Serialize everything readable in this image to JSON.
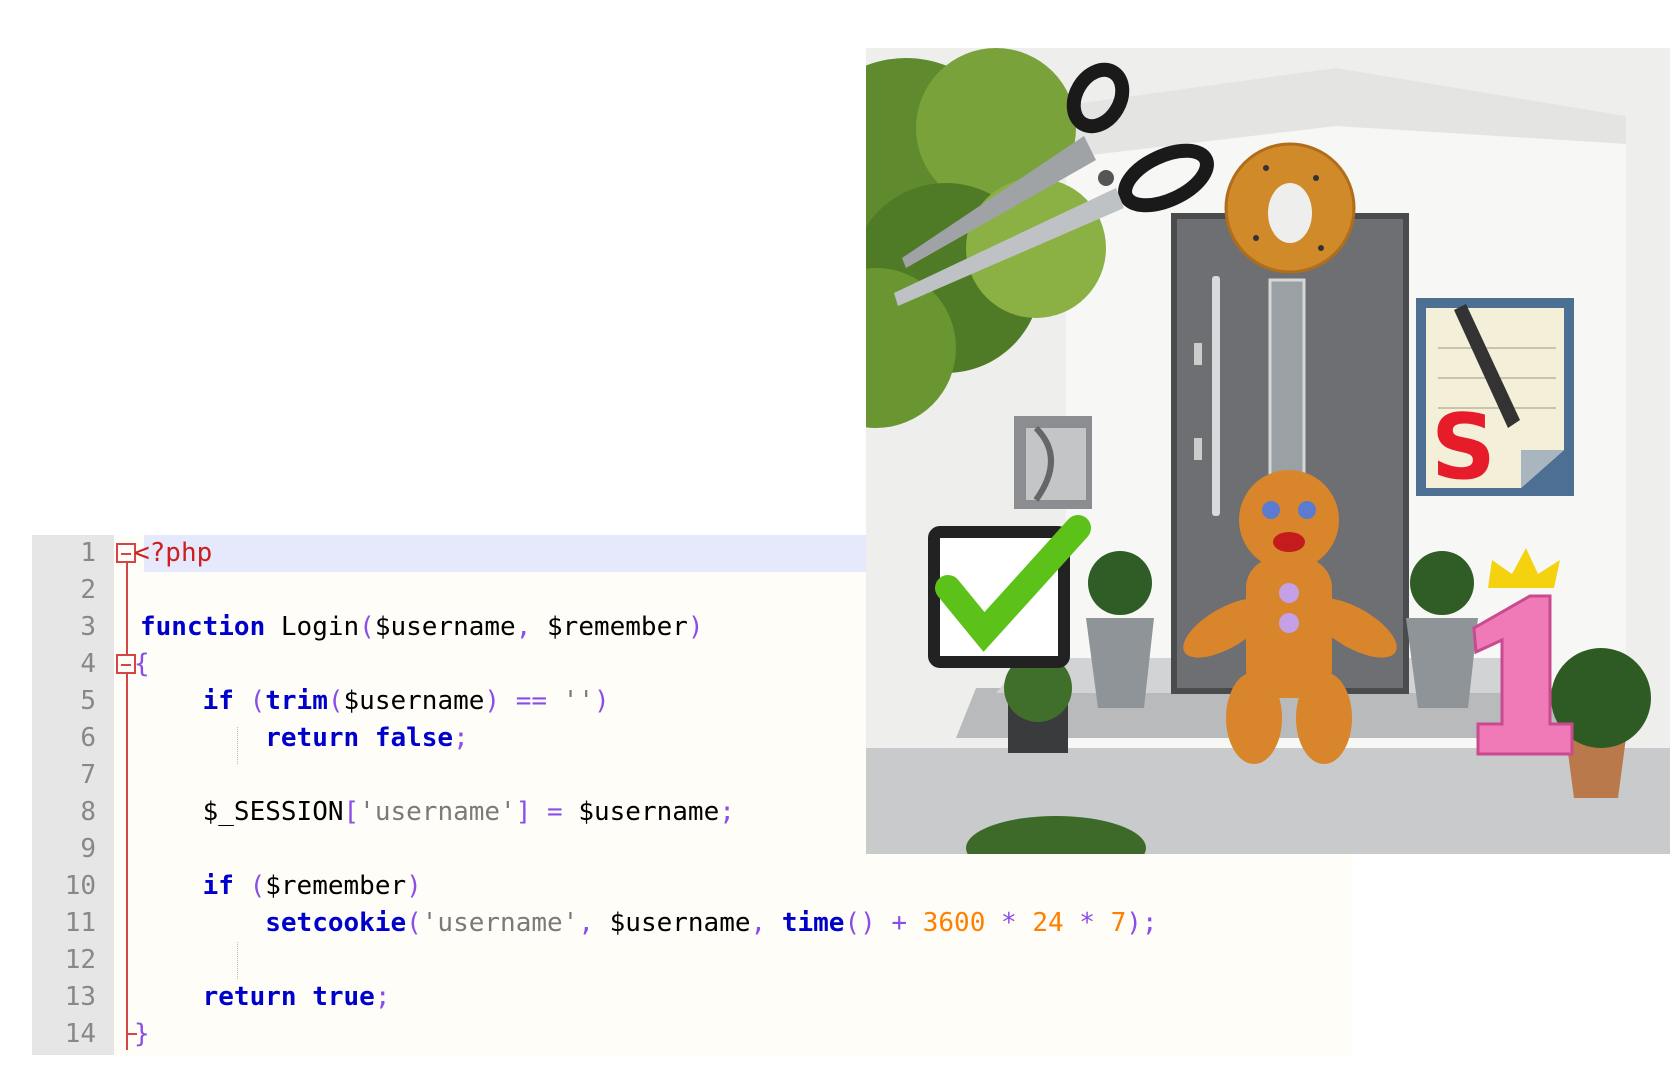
{
  "editor": {
    "line_numbers": [
      "1",
      "2",
      "3",
      "4",
      "5",
      "6",
      "7",
      "8",
      "9",
      "10",
      "11",
      "12",
      "13",
      "14"
    ],
    "lines": [
      [
        {
          "t": "<?php",
          "c": "php"
        }
      ],
      [],
      [
        {
          "t": "function",
          "c": "kw"
        },
        {
          "t": " Login",
          "c": "fn"
        },
        {
          "t": "(",
          "c": "op"
        },
        {
          "t": "$username",
          "c": "var"
        },
        {
          "t": ", ",
          "c": "op"
        },
        {
          "t": "$remember",
          "c": "var"
        },
        {
          "t": ")",
          "c": "op"
        }
      ],
      [
        {
          "t": "{",
          "c": "op"
        }
      ],
      [
        {
          "t": "    "
        },
        {
          "t": "if",
          "c": "kw"
        },
        {
          "t": " (",
          "c": "op"
        },
        {
          "t": "trim",
          "c": "kw"
        },
        {
          "t": "(",
          "c": "op"
        },
        {
          "t": "$username",
          "c": "var"
        },
        {
          "t": ") == ",
          "c": "op"
        },
        {
          "t": "''",
          "c": "str"
        },
        {
          "t": ")",
          "c": "op"
        }
      ],
      [
        {
          "t": "        "
        },
        {
          "t": "return",
          "c": "kw"
        },
        {
          "t": " "
        },
        {
          "t": "false",
          "c": "kw"
        },
        {
          "t": ";",
          "c": "op"
        }
      ],
      [],
      [
        {
          "t": "    "
        },
        {
          "t": "$_SESSION",
          "c": "var"
        },
        {
          "t": "[",
          "c": "op"
        },
        {
          "t": "'username'",
          "c": "str"
        },
        {
          "t": "] = ",
          "c": "op"
        },
        {
          "t": "$username",
          "c": "var"
        },
        {
          "t": ";",
          "c": "op"
        }
      ],
      [],
      [
        {
          "t": "    "
        },
        {
          "t": "if",
          "c": "kw"
        },
        {
          "t": " (",
          "c": "op"
        },
        {
          "t": "$remember",
          "c": "var"
        },
        {
          "t": ")",
          "c": "op"
        }
      ],
      [
        {
          "t": "        "
        },
        {
          "t": "setcookie",
          "c": "kw"
        },
        {
          "t": "(",
          "c": "op"
        },
        {
          "t": "'username'",
          "c": "str"
        },
        {
          "t": ", ",
          "c": "op"
        },
        {
          "t": "$username",
          "c": "var"
        },
        {
          "t": ", ",
          "c": "op"
        },
        {
          "t": "time",
          "c": "kw"
        },
        {
          "t": "() + ",
          "c": "op"
        },
        {
          "t": "3600",
          "c": "num"
        },
        {
          "t": " * ",
          "c": "op"
        },
        {
          "t": "24",
          "c": "num"
        },
        {
          "t": " * ",
          "c": "op"
        },
        {
          "t": "7",
          "c": "num"
        },
        {
          "t": ");",
          "c": "op"
        }
      ],
      [],
      [
        {
          "t": "    "
        },
        {
          "t": "return",
          "c": "kw"
        },
        {
          "t": " "
        },
        {
          "t": "true",
          "c": "kw"
        },
        {
          "t": ";",
          "c": "op"
        }
      ],
      [
        {
          "t": "}",
          "c": "op"
        }
      ]
    ]
  },
  "photo": {
    "icons": [
      "scissors-icon",
      "bagel-icon",
      "document-pen-icon",
      "checkbox-checked-icon",
      "gingerbread-man-icon",
      "number-one-crown-icon",
      "mailbox-icon",
      "door-icon",
      "plant-pot-icon",
      "tree-icon"
    ],
    "colors": {
      "wall": "#f1f1ef",
      "door": "#6e6f72",
      "roof": "#e8e8e6",
      "check": "#5cc21a",
      "ginger": "#d9852b",
      "pink": "#f07ab8",
      "crown": "#f5d20f"
    }
  }
}
